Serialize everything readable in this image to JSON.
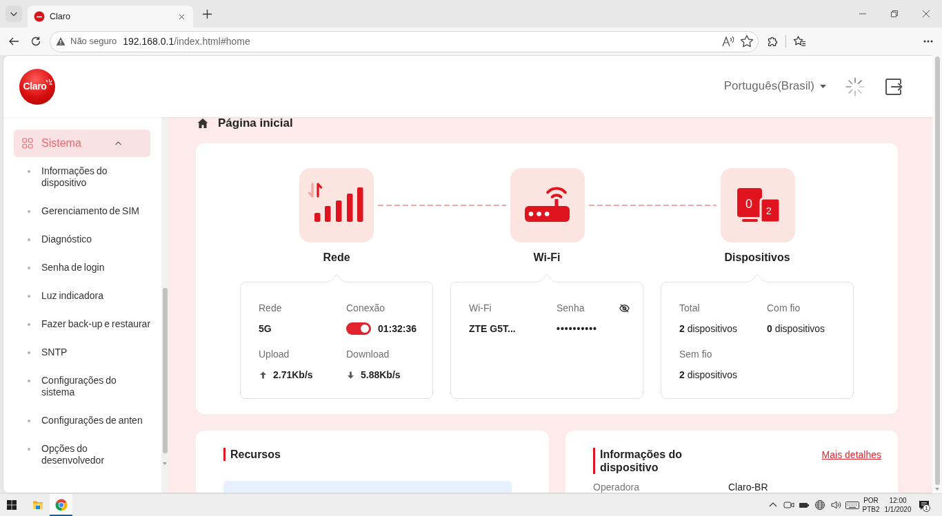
{
  "browser": {
    "tab_title": "Claro",
    "address": {
      "security": "Não seguro",
      "host": "192.168.0.1",
      "path": "/index.html#home"
    }
  },
  "header": {
    "logo_text": "Claro",
    "language": "Português(Brasil)"
  },
  "sidebar": {
    "items": [
      {
        "label": "Sistema",
        "selected": true,
        "expanded": true,
        "children": [
          {
            "label": "Informações do dispositivo",
            "selected": false
          },
          {
            "label": "Gerenciamento de SIM",
            "selected": false
          },
          {
            "label": "Diagnóstico",
            "selected": false
          },
          {
            "label": "Senha de login",
            "selected": false
          },
          {
            "label": "Luz indicadora",
            "selected": false
          },
          {
            "label": "Fazer back-up e restaurar",
            "selected": false
          },
          {
            "label": "SNTP",
            "selected": false
          },
          {
            "label": "Configurações do sistema",
            "selected": false
          },
          {
            "label": "Configurações de anten",
            "selected": false
          },
          {
            "label": "Opções do desenvolvedor",
            "selected": false
          }
        ]
      }
    ]
  },
  "page_title": "Página inicial",
  "overview": {
    "nodes": [
      {
        "kind": "network",
        "label": "Rede",
        "fields": [
          {
            "kind": "text",
            "label": "Rede",
            "value": "5G"
          },
          {
            "kind": "switch",
            "label": "Conexão",
            "on": true,
            "value": "01:32:36"
          },
          {
            "kind": "upload",
            "label": "Upload",
            "value": "2.71Kb/s"
          },
          {
            "kind": "download",
            "label": "Download",
            "value": "5.88Kb/s"
          }
        ]
      },
      {
        "kind": "wifi",
        "label": "Wi-Fi",
        "fields": [
          {
            "kind": "text",
            "label": "Wi-Fi",
            "value": "ZTE G5T..."
          },
          {
            "kind": "password",
            "label": "Senha",
            "revealed": false,
            "value": "••••••••••"
          }
        ]
      },
      {
        "kind": "devices",
        "label": "Dispositivos",
        "icon_numbers": [
          "0",
          "2"
        ],
        "fields": [
          {
            "kind": "count",
            "label": "Total",
            "value": "**2** dispositivos"
          },
          {
            "kind": "count",
            "label": "Com fio",
            "value": "**0** dispositivos"
          },
          {
            "kind": "count",
            "label": "Sem fio",
            "value": "**2** dispositivos"
          }
        ]
      }
    ]
  },
  "cards": [
    {
      "title": "Recursos"
    },
    {
      "title": "Informações do dispositivo",
      "link": "Mais detalhes",
      "rows": [
        {
          "label": "Operadora",
          "value": "Claro-BR"
        }
      ]
    }
  ],
  "taskbar": {
    "apps": [
      {
        "kind": "start",
        "selected": false
      },
      {
        "kind": "files",
        "selected": false
      },
      {
        "kind": "browser",
        "selected": true
      }
    ],
    "tray": {
      "input_language": "POR",
      "keyboard_layout": "PTB2",
      "time": "12:00",
      "date": "1/1/2020",
      "notification_count": "1"
    }
  }
}
